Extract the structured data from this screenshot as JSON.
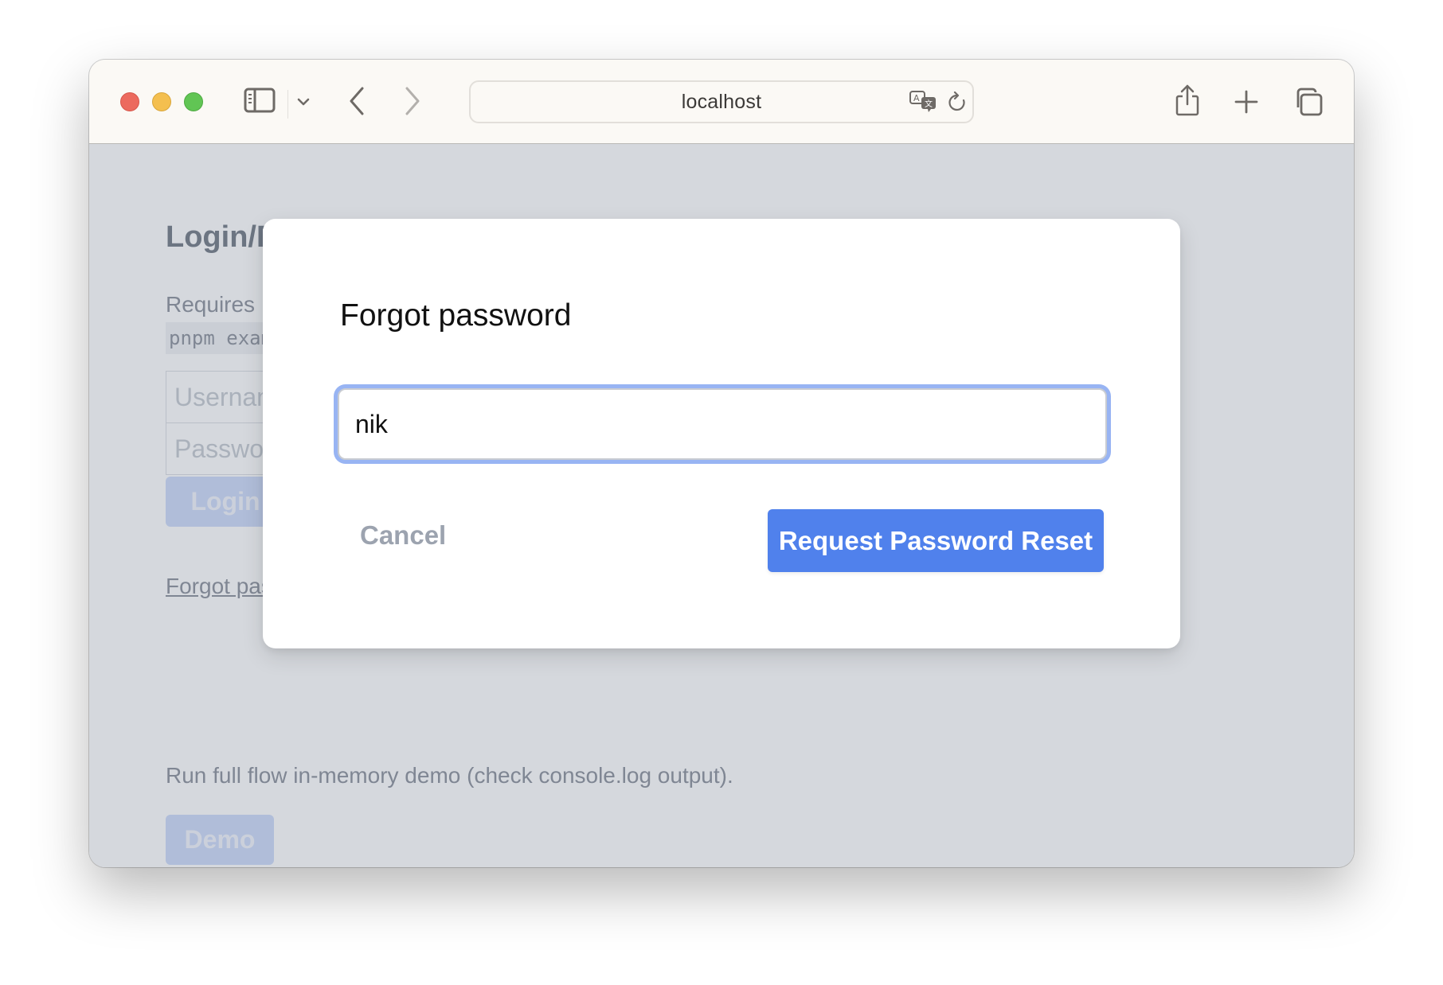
{
  "browser": {
    "url": "localhost",
    "buttons": {
      "close": "close",
      "minimize": "minimize",
      "zoom": "zoom"
    },
    "icons": {
      "sidebar": "sidebar-icon",
      "sidebar_menu": "chevron-down-icon",
      "back": "chevron-left-icon",
      "forward": "chevron-right-icon",
      "translate": "translate-icon",
      "reload": "reload-icon",
      "share": "share-icon",
      "new_tab": "plus-icon",
      "tabs_overview": "tabs-overview-icon"
    }
  },
  "page": {
    "title": "Login/Register",
    "requires_text": "Requires",
    "code_snippet": "pnpm example",
    "username_placeholder": "Username",
    "password_placeholder": "Password",
    "login_label": "Login",
    "forgot_link": "Forgot password",
    "run_text": "Run full flow in-memory demo (check console.log output).",
    "demo_label": "Demo"
  },
  "modal": {
    "title": "Forgot password",
    "input_value": "nik",
    "cancel_label": "Cancel",
    "submit_label": "Request Password Reset",
    "accent_color": "#5081ec",
    "focus_ring_color": "#98b4f3"
  }
}
